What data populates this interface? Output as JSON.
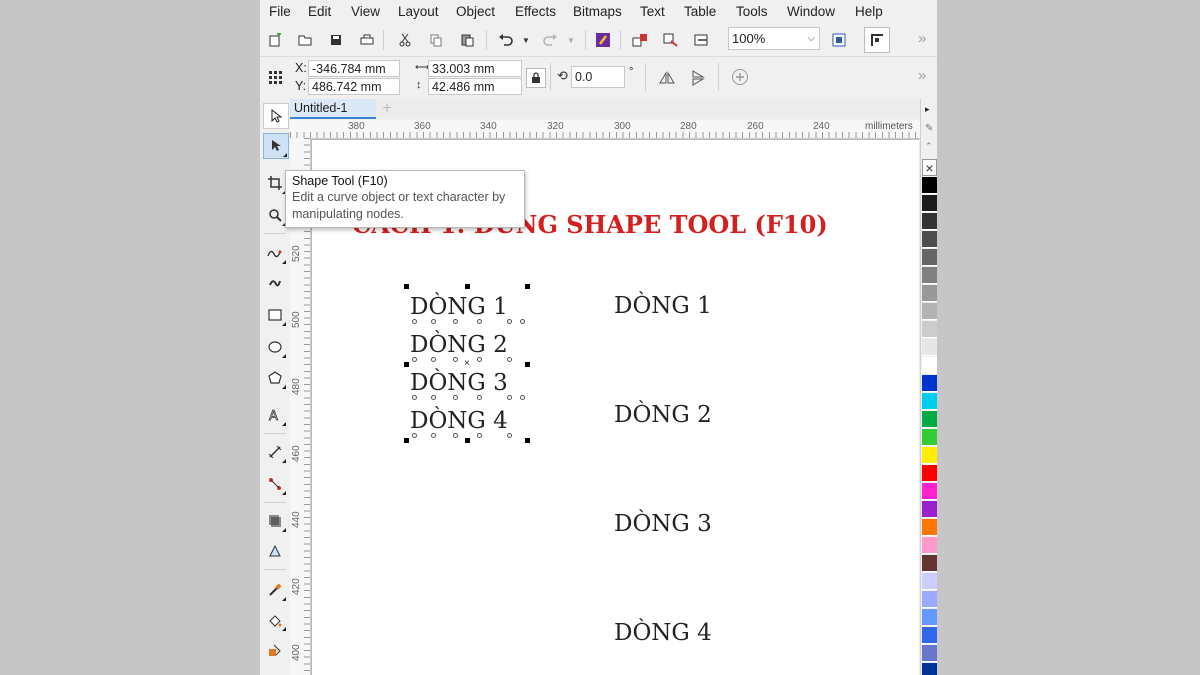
{
  "menu": [
    "File",
    "Edit",
    "View",
    "Layout",
    "Object",
    "Effects",
    "Bitmaps",
    "Text",
    "Table",
    "Tools",
    "Window",
    "Help"
  ],
  "toolbar": {
    "zoom_value": "100%",
    "icons": [
      "new-document-icon",
      "open-icon",
      "save-icon",
      "print-icon",
      "cut-icon",
      "copy-icon",
      "paste-icon",
      "undo-icon",
      "redo-icon",
      "search-content-icon",
      "import-icon",
      "export-icon",
      "publish-pdf-icon",
      "zoom-dropdown",
      "full-screen-icon",
      "snap-icon",
      "overflow-icon"
    ]
  },
  "properties": {
    "x_label": "X:",
    "x_value": "-346.784 mm",
    "y_label": "Y:",
    "y_value": "486.742 mm",
    "width_value": "33.003 mm",
    "height_value": "42.486 mm",
    "rotation_value": "0.0",
    "degree_symbol": "°"
  },
  "document_tab": {
    "title": "Untitled-1",
    "add_symbol": "+"
  },
  "ruler": {
    "unit": "millimeters",
    "h_labels": [
      "380",
      "360",
      "340",
      "320",
      "300",
      "280",
      "260",
      "240"
    ],
    "v_labels": [
      "520",
      "500",
      "480",
      "460",
      "440",
      "420",
      "400"
    ]
  },
  "tooltip": {
    "title": "Shape Tool (F10)",
    "description": "Edit a curve object or text character by manipulating nodes."
  },
  "canvas": {
    "heading": "CÁCH 1: DÙNG SHAPE TOOL (F10)",
    "left_lines": [
      "DÒNG 1",
      "DÒNG 2",
      "DÒNG 3",
      "DÒNG 4"
    ],
    "right_lines": [
      "DÒNG 1",
      "DÒNG 2",
      "DÒNG 3",
      "DÒNG 4"
    ]
  },
  "palette_colors": [
    "#000000",
    "#1a1a1a",
    "#333333",
    "#4d4d4d",
    "#666666",
    "#808080",
    "#999999",
    "#b3b3b3",
    "#cccccc",
    "#e6e6e6",
    "#ffffff",
    "#0033cc",
    "#00ccee",
    "#00aa44",
    "#33cc33",
    "#ffee00",
    "#ff0000",
    "#ff22cc",
    "#9922cc",
    "#ff7700",
    "#ff99cc",
    "#663333",
    "#ccccff",
    "#99aaff",
    "#6699ff",
    "#3366ee",
    "#6677cc",
    "#003399"
  ]
}
